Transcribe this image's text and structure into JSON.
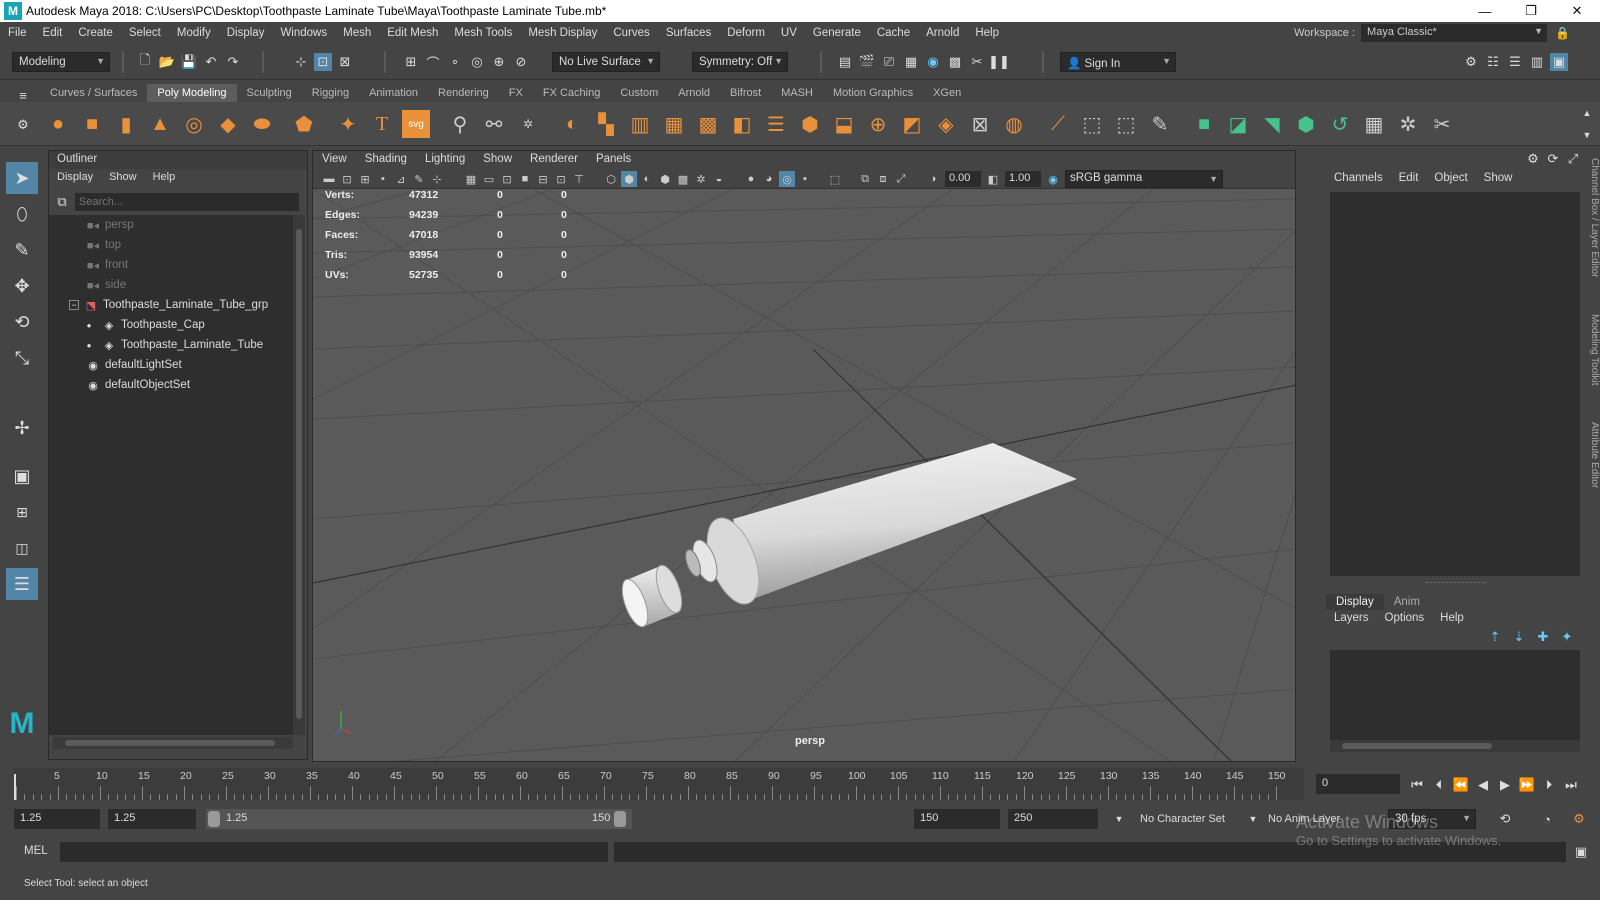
{
  "window": {
    "title": "Autodesk Maya 2018: C:\\Users\\PC\\Desktop\\Toothpaste Laminate Tube\\Maya\\Toothpaste Laminate Tube.mb*",
    "logo": "M"
  },
  "menu": [
    "File",
    "Edit",
    "Create",
    "Select",
    "Modify",
    "Display",
    "Windows",
    "Mesh",
    "Edit Mesh",
    "Mesh Tools",
    "Mesh Display",
    "Curves",
    "Surfaces",
    "Deform",
    "UV",
    "Generate",
    "Cache",
    "Arnold",
    "Help"
  ],
  "workspace": {
    "label": "Workspace :",
    "value": "Maya Classic*"
  },
  "statusline": {
    "mode": "Modeling",
    "live_surface": "No Live Surface",
    "symmetry": "Symmetry: Off",
    "sign_in": "Sign In"
  },
  "shelf_tabs": [
    "Curves / Surfaces",
    "Poly Modeling",
    "Sculpting",
    "Rigging",
    "Animation",
    "Rendering",
    "FX",
    "FX Caching",
    "Custom",
    "Arnold",
    "Bifrost",
    "MASH",
    "Motion Graphics",
    "XGen"
  ],
  "shelf_active": "Poly Modeling",
  "outliner": {
    "title": "Outliner",
    "menu": [
      "Display",
      "Show",
      "Help"
    ],
    "search_placeholder": "Search...",
    "items": [
      {
        "label": "persp",
        "type": "camera",
        "dim": true
      },
      {
        "label": "top",
        "type": "camera",
        "dim": true
      },
      {
        "label": "front",
        "type": "camera",
        "dim": true
      },
      {
        "label": "side",
        "type": "camera",
        "dim": true
      },
      {
        "label": "Toothpaste_Laminate_Tube_grp",
        "type": "group",
        "dim": false
      },
      {
        "label": "Toothpaste_Cap",
        "type": "mesh",
        "dim": false
      },
      {
        "label": "Toothpaste_Laminate_Tube",
        "type": "mesh",
        "dim": false
      },
      {
        "label": "defaultLightSet",
        "type": "set",
        "dim": false
      },
      {
        "label": "defaultObjectSet",
        "type": "set",
        "dim": false
      }
    ]
  },
  "viewport": {
    "menu": [
      "View",
      "Shading",
      "Lighting",
      "Show",
      "Renderer",
      "Panels"
    ],
    "exposure": "0.00",
    "gamma": "1.00",
    "color_space": "sRGB gamma",
    "camera_label": "persp",
    "hud": [
      {
        "label": "Verts:",
        "a": "47312",
        "b": "0",
        "c": "0"
      },
      {
        "label": "Edges:",
        "a": "94239",
        "b": "0",
        "c": "0"
      },
      {
        "label": "Faces:",
        "a": "47018",
        "b": "0",
        "c": "0"
      },
      {
        "label": "Tris:",
        "a": "93954",
        "b": "0",
        "c": "0"
      },
      {
        "label": "UVs:",
        "a": "52735",
        "b": "0",
        "c": "0"
      }
    ]
  },
  "channelbox": {
    "menu": [
      "Channels",
      "Edit",
      "Object",
      "Show"
    ],
    "layer_tabs": [
      "Display",
      "Anim"
    ],
    "layer_menu": [
      "Layers",
      "Options",
      "Help"
    ],
    "side_tabs": [
      "Channel Box / Layer Editor",
      "Modeling Toolkit",
      "Attribute Editor"
    ]
  },
  "timeline": {
    "labels": [
      "5",
      "10",
      "15",
      "20",
      "25",
      "30",
      "35",
      "40",
      "45",
      "50",
      "55",
      "60",
      "65",
      "70",
      "75",
      "80",
      "85",
      "90",
      "95",
      "100",
      "105",
      "110",
      "115",
      "120",
      "125",
      "130",
      "135",
      "140",
      "145",
      "150"
    ],
    "current_frame": "0"
  },
  "range": {
    "start": "1.25",
    "anim_start": "1.25",
    "slider_start": "1.25",
    "slider_end": "150",
    "anim_end": "150",
    "end": "250",
    "character_set": "No Character Set",
    "anim_layer": "No Anim Layer",
    "fps": "30 fps"
  },
  "cmdline": {
    "label": "MEL"
  },
  "help_line": "Select Tool: select an object",
  "watermark": {
    "title": "Activate Windows",
    "subtitle": "Go to Settings to activate Windows."
  }
}
